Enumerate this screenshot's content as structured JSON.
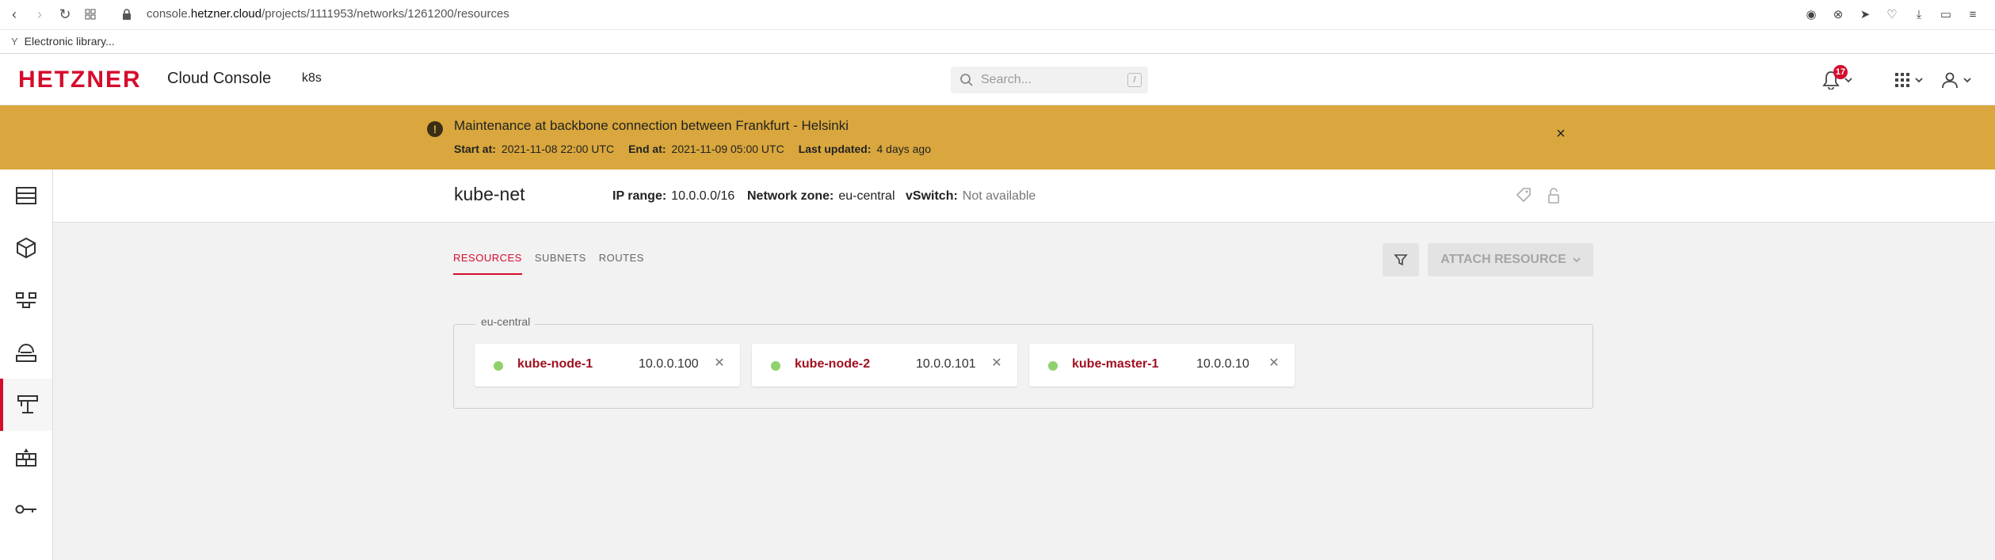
{
  "browser": {
    "url_prefix": "console.",
    "url_host": "hetzner.cloud",
    "url_path": "/projects/1111953/networks/1261200/resources",
    "bookmark_label": "Electronic library..."
  },
  "header": {
    "brand": "HETZNER",
    "app_title": "Cloud Console",
    "project": "k8s",
    "search_placeholder": "Search...",
    "search_shortcut": "/",
    "notification_count": "17"
  },
  "banner": {
    "title": "Maintenance at backbone connection between Frankfurt - Helsinki",
    "start_label": "Start at:",
    "start_value": "2021-11-08 22:00 UTC",
    "end_label": "End at:",
    "end_value": "2021-11-09 05:00 UTC",
    "updated_label": "Last updated:",
    "updated_value": "4 days ago",
    "close_symbol": "×"
  },
  "network": {
    "name": "kube-net",
    "ip_range_label": "IP range:",
    "ip_range": "10.0.0.0/16",
    "zone_label": "Network zone:",
    "zone": "eu-central",
    "vswitch_label": "vSwitch:",
    "vswitch": "Not available"
  },
  "tabs": [
    {
      "label": "RESOURCES",
      "active": true
    },
    {
      "label": "SUBNETS",
      "active": false
    },
    {
      "label": "ROUTES",
      "active": false
    }
  ],
  "actions": {
    "attach_label": "ATTACH RESOURCE"
  },
  "zone_group": {
    "label": "eu-central",
    "resources": [
      {
        "name": "kube-node-1",
        "ip": "10.0.0.100",
        "status_color": "#8fd16c"
      },
      {
        "name": "kube-node-2",
        "ip": "10.0.0.101",
        "status_color": "#8fd16c"
      },
      {
        "name": "kube-master-1",
        "ip": "10.0.0.10",
        "status_color": "#8fd16c"
      }
    ]
  },
  "colors": {
    "brand_red": "#d50c2d",
    "banner": "#d9a73d"
  }
}
